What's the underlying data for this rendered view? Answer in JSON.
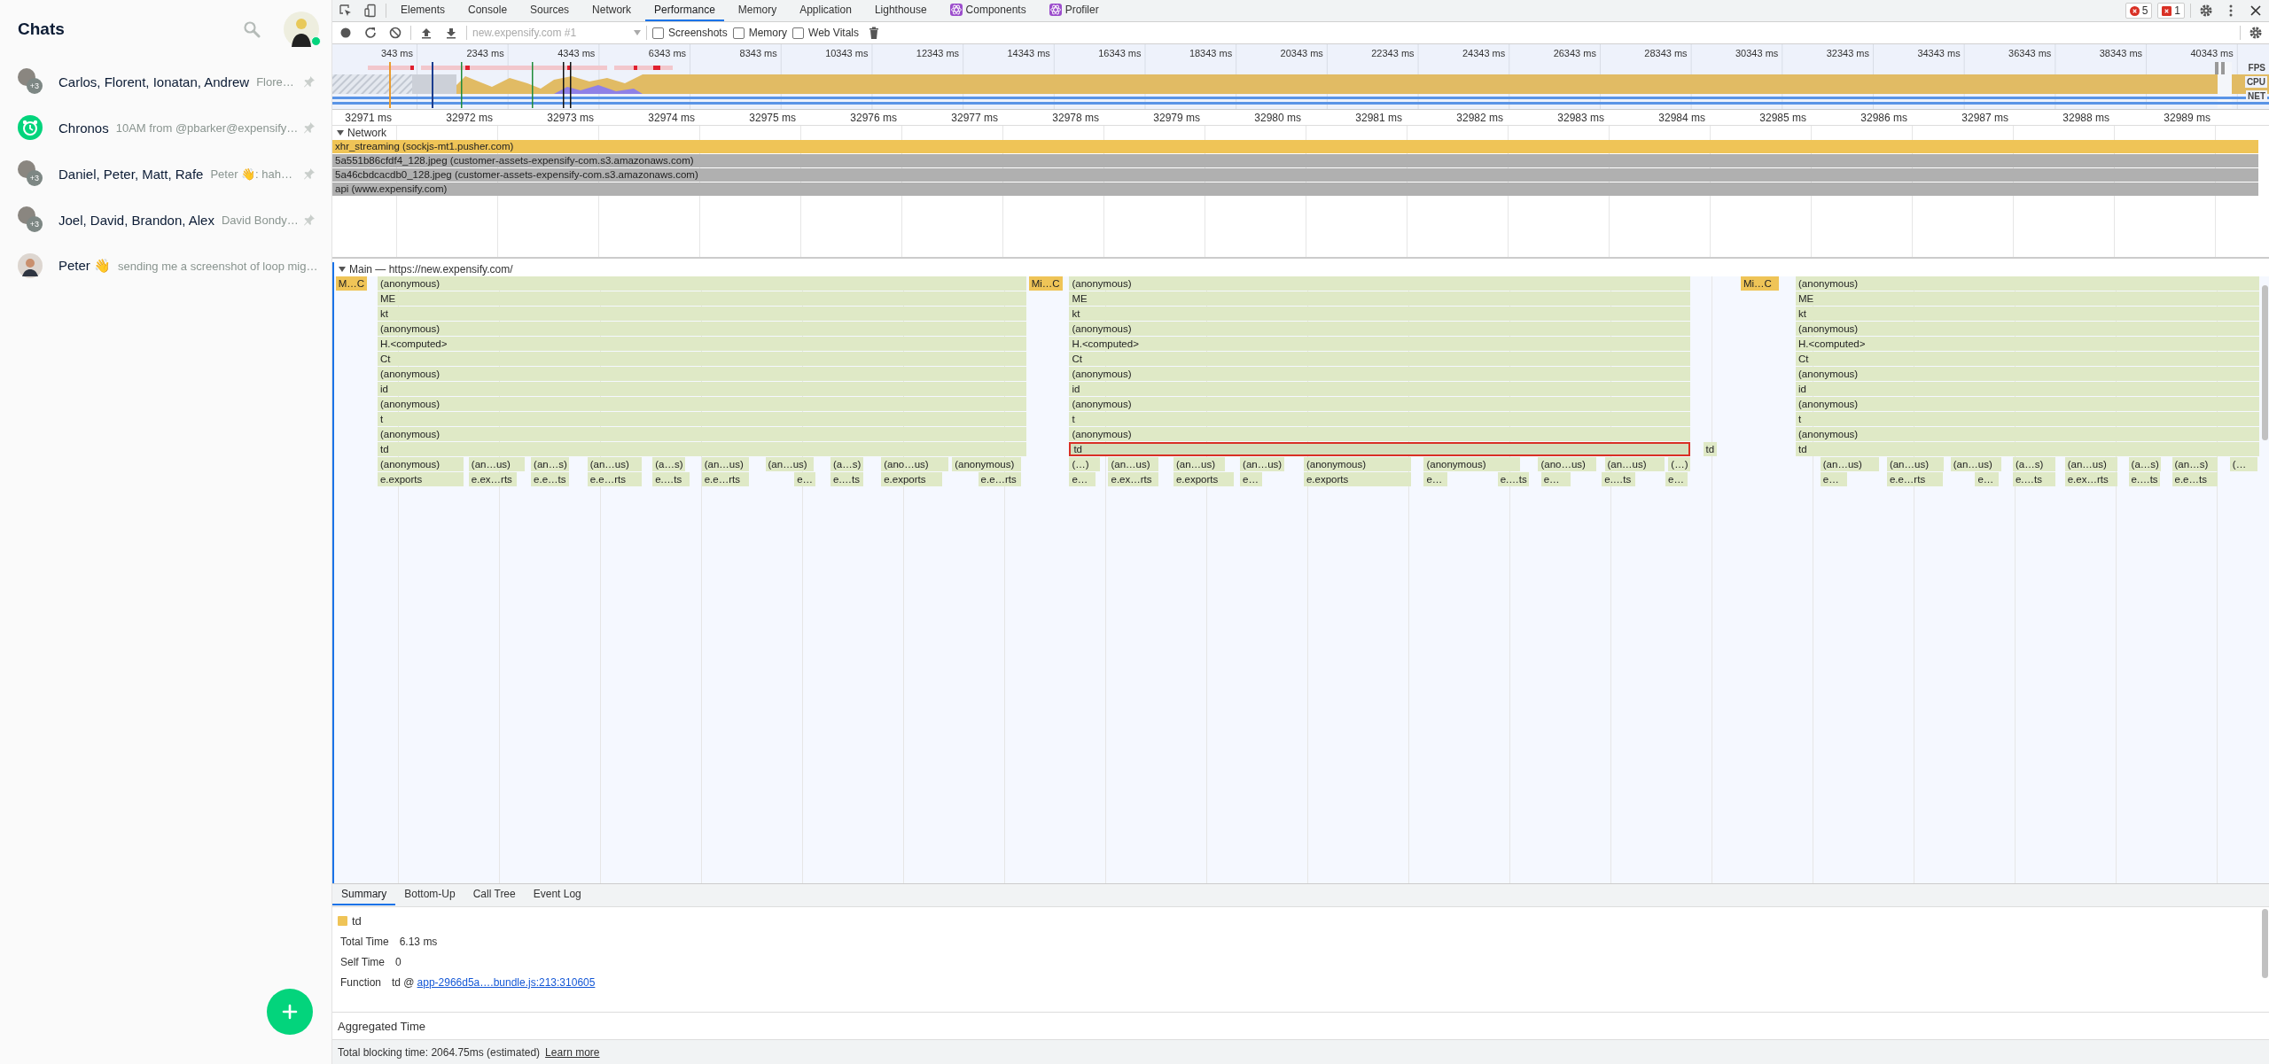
{
  "sidebar": {
    "title": "Chats",
    "chats": [
      {
        "name": "Carlos, Florent, Ionatan, Andrew",
        "preview": "Flore…",
        "kind": "group",
        "count": "+3"
      },
      {
        "name": "Chronos",
        "preview": "10AM from @pbarker@expensify…",
        "kind": "bot"
      },
      {
        "name": "Daniel, Peter, Matt, Rafe",
        "preview": "Peter 👋: hah…",
        "kind": "group",
        "count": "+3"
      },
      {
        "name": "Joel, David, Brandon, Alex",
        "preview": "David Bondy…",
        "kind": "group",
        "count": "+3"
      },
      {
        "name": "Peter 👋",
        "preview": "sending me a screenshot of loop mig…",
        "kind": "person"
      }
    ]
  },
  "devtools": {
    "tabs": [
      {
        "label": "Elements",
        "selected": false
      },
      {
        "label": "Console",
        "selected": false
      },
      {
        "label": "Sources",
        "selected": false
      },
      {
        "label": "Network",
        "selected": false
      },
      {
        "label": "Performance",
        "selected": true
      },
      {
        "label": "Memory",
        "selected": false
      },
      {
        "label": "Application",
        "selected": false
      },
      {
        "label": "Lighthouse",
        "selected": false
      },
      {
        "label": "Components",
        "selected": false,
        "kind": "react"
      },
      {
        "label": "Profiler",
        "selected": false,
        "kind": "react"
      }
    ],
    "errors": "5",
    "warnings": "1",
    "toolbar": {
      "target": "new.expensify.com #1",
      "checkboxes": [
        {
          "label": "Screenshots",
          "checked": false
        },
        {
          "label": "Memory",
          "checked": false
        },
        {
          "label": "Web Vitals",
          "checked": false
        }
      ]
    },
    "overview": {
      "ticks": [
        "343 ms",
        "2343 ms",
        "4343 ms",
        "6343 ms",
        "8343 ms",
        "10343 ms",
        "12343 ms",
        "14343 ms",
        "16343 ms",
        "18343 ms",
        "20343 ms",
        "22343 ms",
        "24343 ms",
        "26343 ms",
        "28343 ms",
        "30343 ms",
        "32343 ms",
        "34343 ms",
        "36343 ms",
        "38343 ms",
        "40343 ms"
      ],
      "tracks": [
        "FPS",
        "CPU",
        "NET"
      ]
    },
    "ruler": [
      "32971 ms",
      "32972 ms",
      "32973 ms",
      "32974 ms",
      "32975 ms",
      "32976 ms",
      "32977 ms",
      "32978 ms",
      "32979 ms",
      "32980 ms",
      "32981 ms",
      "32982 ms",
      "32983 ms",
      "32984 ms",
      "32985 ms",
      "32986 ms",
      "32987 ms",
      "32988 ms",
      "32989 ms"
    ],
    "network": {
      "title": "Network",
      "requests": [
        {
          "label": "xhr_streaming (sockjs-mt1.pusher.com)",
          "color": "#efc457"
        },
        {
          "label": "5a551b86cfdf4_128.jpeg (customer-assets-expensify-com.s3.amazonaws.com)",
          "color": "#b0b0b0"
        },
        {
          "label": "5a46cbdcacdb0_128.jpeg (customer-assets-expensify-com.s3.amazonaws.com)",
          "color": "#b0b0b0"
        },
        {
          "label": "api (www.expensify.com)",
          "color": "#b0b0b0"
        }
      ]
    },
    "main": {
      "title": "Main — https://new.expensify.com/",
      "groups": [
        {
          "task": "M…C",
          "stack": [
            {
              "label": "(anonymous)",
              "selected": false
            },
            {
              "label": "ME",
              "selected": false
            },
            {
              "label": "kt",
              "selected": false
            },
            {
              "label": "(anonymous)",
              "selected": false
            },
            {
              "label": "H.<computed>",
              "selected": false
            },
            {
              "label": "Ct",
              "selected": false
            },
            {
              "label": "(anonymous)",
              "selected": false
            },
            {
              "label": "id",
              "selected": false
            },
            {
              "label": "(anonymous)",
              "selected": false
            },
            {
              "label": "t",
              "selected": false
            },
            {
              "label": "(anonymous)",
              "selected": false
            },
            {
              "label": "td",
              "selected": false
            }
          ],
          "children": [
            "(anonymous)",
            "(an…us)",
            "(an…s)",
            "(an…us)",
            "(a…s)",
            "(an…us)",
            "(an…us)",
            "(a…s)",
            "(ano…us)",
            "(anonymous)"
          ],
          "exports": [
            "e.exports",
            "e.ex…rts",
            "e.e…ts",
            "e.e…rts",
            "e.…ts",
            "e.e…rts",
            "e…",
            "e.…ts",
            "e.exports",
            "e.e…rts"
          ]
        },
        {
          "task": "Mi…C",
          "stack": [
            {
              "label": "(anonymous)",
              "selected": false
            },
            {
              "label": "ME",
              "selected": false
            },
            {
              "label": "kt",
              "selected": false
            },
            {
              "label": "(anonymous)",
              "selected": false
            },
            {
              "label": "H.<computed>",
              "selected": false
            },
            {
              "label": "Ct",
              "selected": false
            },
            {
              "label": "(anonymous)",
              "selected": false
            },
            {
              "label": "id",
              "selected": false
            },
            {
              "label": "(anonymous)",
              "selected": false
            },
            {
              "label": "t",
              "selected": false
            },
            {
              "label": "(anonymous)",
              "selected": false
            },
            {
              "label": "td",
              "selected": true
            }
          ],
          "side": "td",
          "children": [
            "(…)",
            "(an…us)",
            "(an…us)",
            "(an…us)",
            "(anonymous)",
            "(anonymous)",
            "(ano…us)",
            "(an…us)",
            "(…)"
          ],
          "exports": [
            "e…",
            "e.ex…rts",
            "e.exports",
            "e…",
            "e.exports",
            "e…",
            "e.…ts",
            "e…",
            "e.…ts",
            "e…"
          ]
        },
        {
          "task": "Mi…C",
          "stack": [
            {
              "label": "(anonymous)",
              "selected": false
            },
            {
              "label": "ME",
              "selected": false
            },
            {
              "label": "kt",
              "selected": false
            },
            {
              "label": "(anonymous)",
              "selected": false
            },
            {
              "label": "H.<computed>",
              "selected": false
            },
            {
              "label": "Ct",
              "selected": false
            },
            {
              "label": "(anonymous)",
              "selected": false
            },
            {
              "label": "id",
              "selected": false
            },
            {
              "label": "(anonymous)",
              "selected": false
            },
            {
              "label": "t",
              "selected": false
            },
            {
              "label": "(anonymous)",
              "selected": false
            },
            {
              "label": "td",
              "selected": false
            }
          ],
          "children": [
            "(an…us)",
            "(an…us)",
            "(an…us)",
            "(a…s)",
            "(an…us)",
            "(a…s)",
            "(an…s)",
            "(…"
          ],
          "exports": [
            "e…",
            "e.e…rts",
            "e…",
            "e.…ts",
            "e.ex…rts",
            "e.…ts",
            "e.e…ts"
          ]
        }
      ]
    },
    "details": {
      "tabs": [
        {
          "label": "Summary",
          "selected": true
        },
        {
          "label": "Bottom-Up",
          "selected": false
        },
        {
          "label": "Call Tree",
          "selected": false
        },
        {
          "label": "Event Log",
          "selected": false
        }
      ],
      "summary": {
        "name": "td",
        "color": "#efc457",
        "rows": [
          {
            "label": "Total Time",
            "value": "6.13 ms"
          },
          {
            "label": "Self Time",
            "value": "0"
          }
        ],
        "function_label": "Function",
        "function_name": "td @",
        "function_link": "app-2966d5a….bundle.js:213:310605"
      },
      "aggregated": "Aggregated Time"
    },
    "footer": {
      "text": "Total blocking time: 2064.75ms (estimated)",
      "link": "Learn more"
    }
  }
}
